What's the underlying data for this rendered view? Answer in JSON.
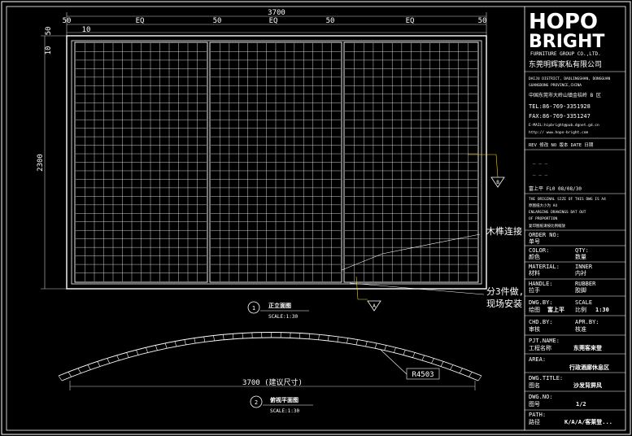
{
  "dimensions": {
    "total_width": "3700",
    "top_segments": [
      "50",
      "EQ",
      "50",
      "EQ",
      "50",
      "EQ",
      "50"
    ],
    "inner_offset": "10",
    "height": "2300",
    "left_small_a": "50",
    "left_small_b": "10",
    "bottom_width": "3700 (建议尺寸)",
    "radius": "R4503"
  },
  "annotations": {
    "wood_joint": "木榫连接",
    "assembly_line1": "分3件做,",
    "assembly_line2": "现场安装",
    "callout_a": "A",
    "callout_b": "B",
    "view1_num": "1",
    "view1_title": "正立面图",
    "view1_scale": "SCALE:1:30",
    "view2_num": "2",
    "view2_title": "俯视平面图",
    "view2_scale": "SCALE:1:30"
  },
  "titleblock": {
    "logo_top": "HOPO",
    "logo_bottom": "BRIGHT",
    "group": "FURNITURE GROUP CO.,LTD.",
    "company_cn": "东莞明辉家私有限公司",
    "address_en1": "DAIJU DISTRICT, DAOLINGSHAN, DONGGUAN",
    "address_en2": "GUANGDONG PROVINCE,CHINA",
    "address_cn": "中国东莞市大岭山镇金桔岭 B 区",
    "tel": "TEL:86-769-3351928",
    "fax": "FAX:86-769-3351247",
    "email": "E-MAIL:hipbright@pub.dgnet.gd.cn",
    "web": "http:// www.hopo-bright.com",
    "rev_header": "REV 修改 NO 版本 DATE 日期",
    "rev_entry": "富上平 FL0 08/08/30",
    "note_en1": "THE ORIGINAL SIZE OF THIS DWG IS A4",
    "note_en2": "原图纸大小为 A4",
    "note_en3": "ENLARGING DRAWINGS DAT OUT",
    "note_en4": "OF PROPORTION",
    "note_cn": "复印图纸请按比例缩放",
    "order_no_label": "ORDER NO:",
    "order_no_cn": "单号",
    "color_label": "COLOR:",
    "color_cn": "颜色",
    "qty_label": "QTY:",
    "qty_cn": "数量",
    "material_label": "MATERIAL:",
    "material_cn": "材料",
    "inner_label": "INNER",
    "inner_cn": "内衬",
    "handle_label": "HANDLE:",
    "handle_cn": "拉手",
    "rubber_label": "RUBBER",
    "rubber_cn": "胶脚",
    "dwg_by_label": "DWG.BY:",
    "dwg_by_cn": "绘图",
    "dwg_by_value": "富上平",
    "scale_label": "SCALE",
    "scale_cn": "比例",
    "scale_value": "1:30",
    "chd_by_label": "CHD.BY:",
    "chd_by_cn": "审核",
    "apr_by_label": "APR.BY:",
    "apr_by_cn": "核准",
    "proj_label": "PJT.NAME:",
    "proj_cn": "工程名称",
    "proj_value": "东莞客来登",
    "area_label": "AREA:",
    "area_value": "行政酒廊休息区",
    "dwg_title_label": "DWG.TITLE:",
    "dwg_title_cn": "图名",
    "dwg_title_value": "沙发背屏风",
    "dwg_no_label": "DWG.NO:",
    "dwg_no_cn": "图号",
    "dwg_no_value": "1/2",
    "path_label": "PATH:",
    "path_cn": "路径",
    "path_value": "K/A/A/客莱登..."
  },
  "colors": {
    "background": "#000000",
    "line": "#ffffff",
    "leader": "#ffd400",
    "dim": "#d8d8d8"
  }
}
